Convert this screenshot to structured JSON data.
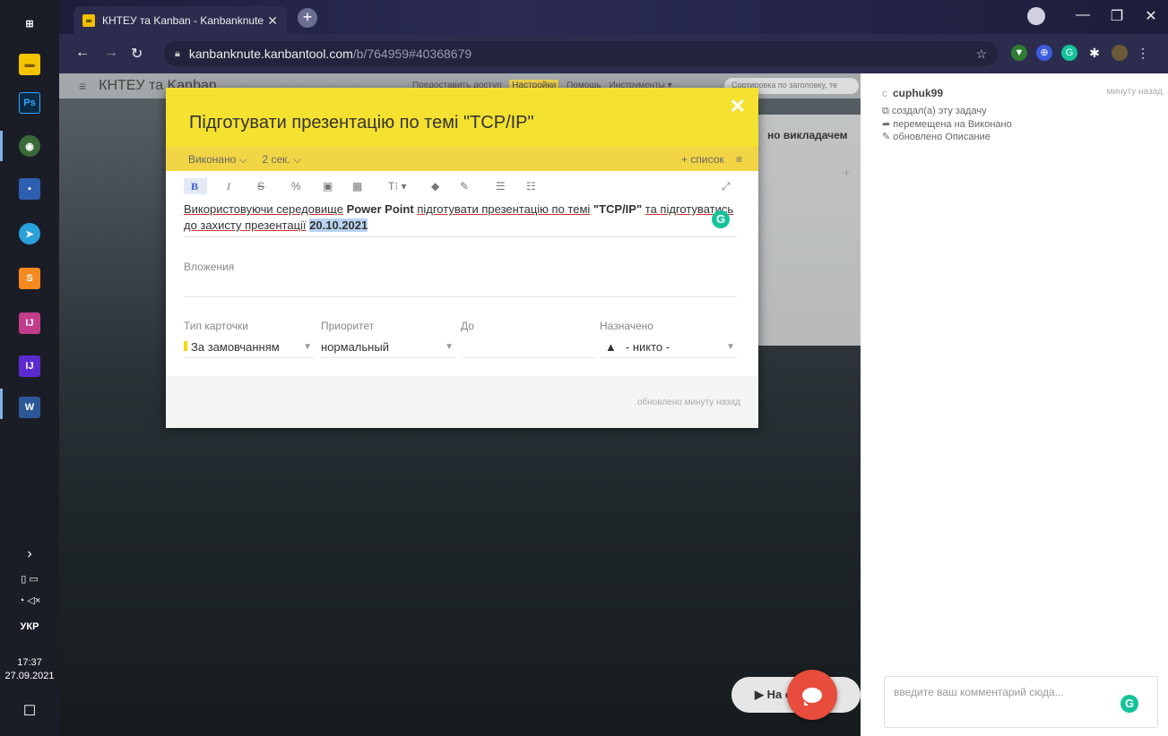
{
  "taskbar": {
    "apps": [
      {
        "name": "windows-start",
        "label": "⊞",
        "color": "#1b1d26"
      },
      {
        "name": "file-explorer",
        "label": "▬",
        "color": "#f5c400"
      },
      {
        "name": "photoshop",
        "label": "Ps",
        "color": "#0a2a44"
      },
      {
        "name": "chrome",
        "label": "◉",
        "color": "#3a6a3a"
      },
      {
        "name": "save-app",
        "label": "▪",
        "color": "#2d5fb0"
      },
      {
        "name": "telegram",
        "label": "➤",
        "color": "#2aa1da"
      },
      {
        "name": "sublime-text",
        "label": "S",
        "color": "#f68a1f"
      },
      {
        "name": "jetbrains-ide",
        "label": "IJ",
        "color": "#c23c8c"
      },
      {
        "name": "jetbrains-ide-2",
        "label": "IJ",
        "color": "#5b2bd0"
      },
      {
        "name": "word",
        "label": "W",
        "color": "#2b5797"
      }
    ],
    "tray_chevron": "›",
    "language": "УКР",
    "time": "17:37",
    "date": "27.09.2021"
  },
  "browser": {
    "tab_title": "КНТЕУ та Kanban - Kanbanknute",
    "tab_favicon": "∞",
    "new_tab": "+",
    "url_domain": "kanbanknute.kanbantool.com",
    "url_path": "/b/764959#40368679",
    "colors": {
      "tab_bg": "#2c2d4e",
      "frame": "#1d1e3a"
    }
  },
  "board": {
    "menu_icon": "≡",
    "title": "КНТЕУ та Kanban",
    "links": [
      "Предоставить доступ",
      "Настройки",
      "Помощь",
      "Инструменты ▾"
    ],
    "sort_placeholder": "Сортировка по заголовку, те",
    "column_header": "но викладачем"
  },
  "card": {
    "title": "Підготувати презентацію по темі \"TCP/IP\"",
    "close": "✕",
    "status": "Виконано ⌵",
    "duration": "2 сек. ⌵",
    "add_list": "+ список",
    "list_menu": "≡",
    "toolbar": [
      "B",
      "I",
      "S",
      "%",
      "▣",
      "▦",
      "T⁝ ▾",
      "◆",
      "✎",
      "☰",
      "☷"
    ],
    "expand": "⤢",
    "description": {
      "part1": "Використовуючи середовище",
      "bold": "Power Point",
      "part2": "підготувати презентацію по темі",
      "bold2": "\"TCP/IP\"",
      "part3": "та підготуватись до захисту презентації",
      "date": "20.10.2021"
    },
    "attachments_label": "Вложения",
    "fields": {
      "type_label": "Тип карточки",
      "type_value": "За замовчанням",
      "priority_label": "Приоритет",
      "priority_value": "нормальный",
      "due_label": "До",
      "due_value": "",
      "assigned_label": "Назначено",
      "assigned_value": "- никто -"
    },
    "updated": "обновлено минуту назад",
    "colors": {
      "header": "#f5e12f",
      "subheader": "#f2d545"
    }
  },
  "activity": {
    "user": "cuphuk99",
    "user_prefix": "c",
    "when": "минуту назад",
    "items": [
      "создал(а) эту задачу",
      "перемещена на Виконано",
      "обновлено Описание"
    ],
    "comment_placeholder": "введите ваш комментарий сюда..."
  },
  "floating": {
    "pill_text": "▶ На   ску"
  },
  "colors": {
    "grammarly": "#15c39a",
    "chat": "#e74c3c"
  }
}
